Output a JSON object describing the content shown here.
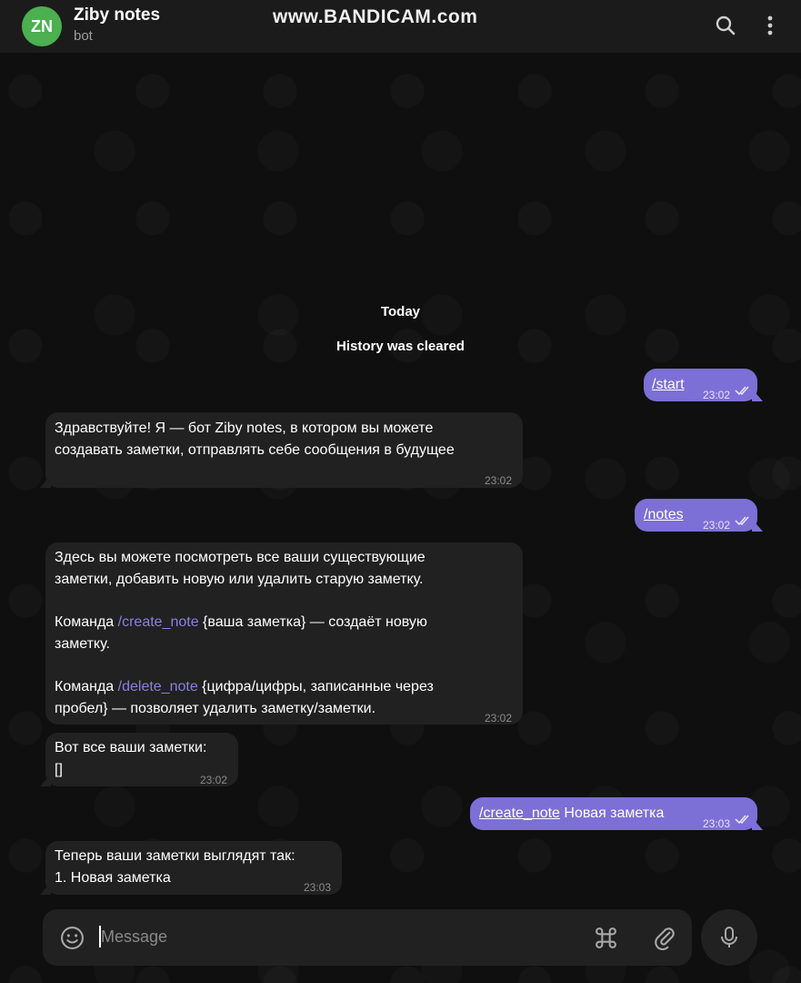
{
  "header": {
    "avatar_initials": "ZN",
    "title": "Ziby notes",
    "subtitle": "bot",
    "watermark": "www.BANDICAM.com",
    "search_icon": "search-icon",
    "menu_icon": "more-vertical-icon"
  },
  "service": {
    "date": "Today",
    "history": "History was cleared"
  },
  "messages": {
    "m1": {
      "cmd": "/start",
      "time": "23:02"
    },
    "m2": {
      "line1": "Здравствуйте! Я — бот Ziby notes, в котором вы можете",
      "line2": "создавать заметки, отправлять себе сообщения в будущее",
      "time": "23:02"
    },
    "m3": {
      "cmd": "/notes",
      "time": "23:02"
    },
    "m4": {
      "p1_line1": "Здесь вы можете посмотреть все ваши существующие",
      "p1_line2": "заметки, добавить новую или удалить старую заметку.",
      "p2_prefix": "Команда ",
      "p2_cmd": "/create_note",
      "p2_suffix": " {ваша заметка} — создаёт новую",
      "p2_line2": "заметку.",
      "p3_prefix": "Команда ",
      "p3_cmd": "/delete_note",
      "p3_suffix": " {цифра/цифры, записанные через",
      "p3_line2": "пробел} — позволяет удалить заметку/заметки.",
      "time": "23:02"
    },
    "m5": {
      "line1": "Вот все ваши заметки:",
      "line2": "[]",
      "time": "23:02"
    },
    "m6": {
      "cmd": "/create_note",
      "text": " Новая заметка",
      "time": "23:03"
    },
    "m7": {
      "line1": "Теперь ваши заметки выглядят так:",
      "line2": "1. Новая заметка",
      "time": "23:03"
    }
  },
  "composer": {
    "placeholder": "Message",
    "emoji_icon": "smile-icon",
    "command_icon": "command-icon",
    "attach_icon": "paperclip-icon",
    "mic_icon": "microphone-icon"
  },
  "colors": {
    "accent": "#7c6fd6",
    "avatar": "#4caf50",
    "incoming_bubble": "#212121",
    "command_link": "#8b80e0"
  }
}
